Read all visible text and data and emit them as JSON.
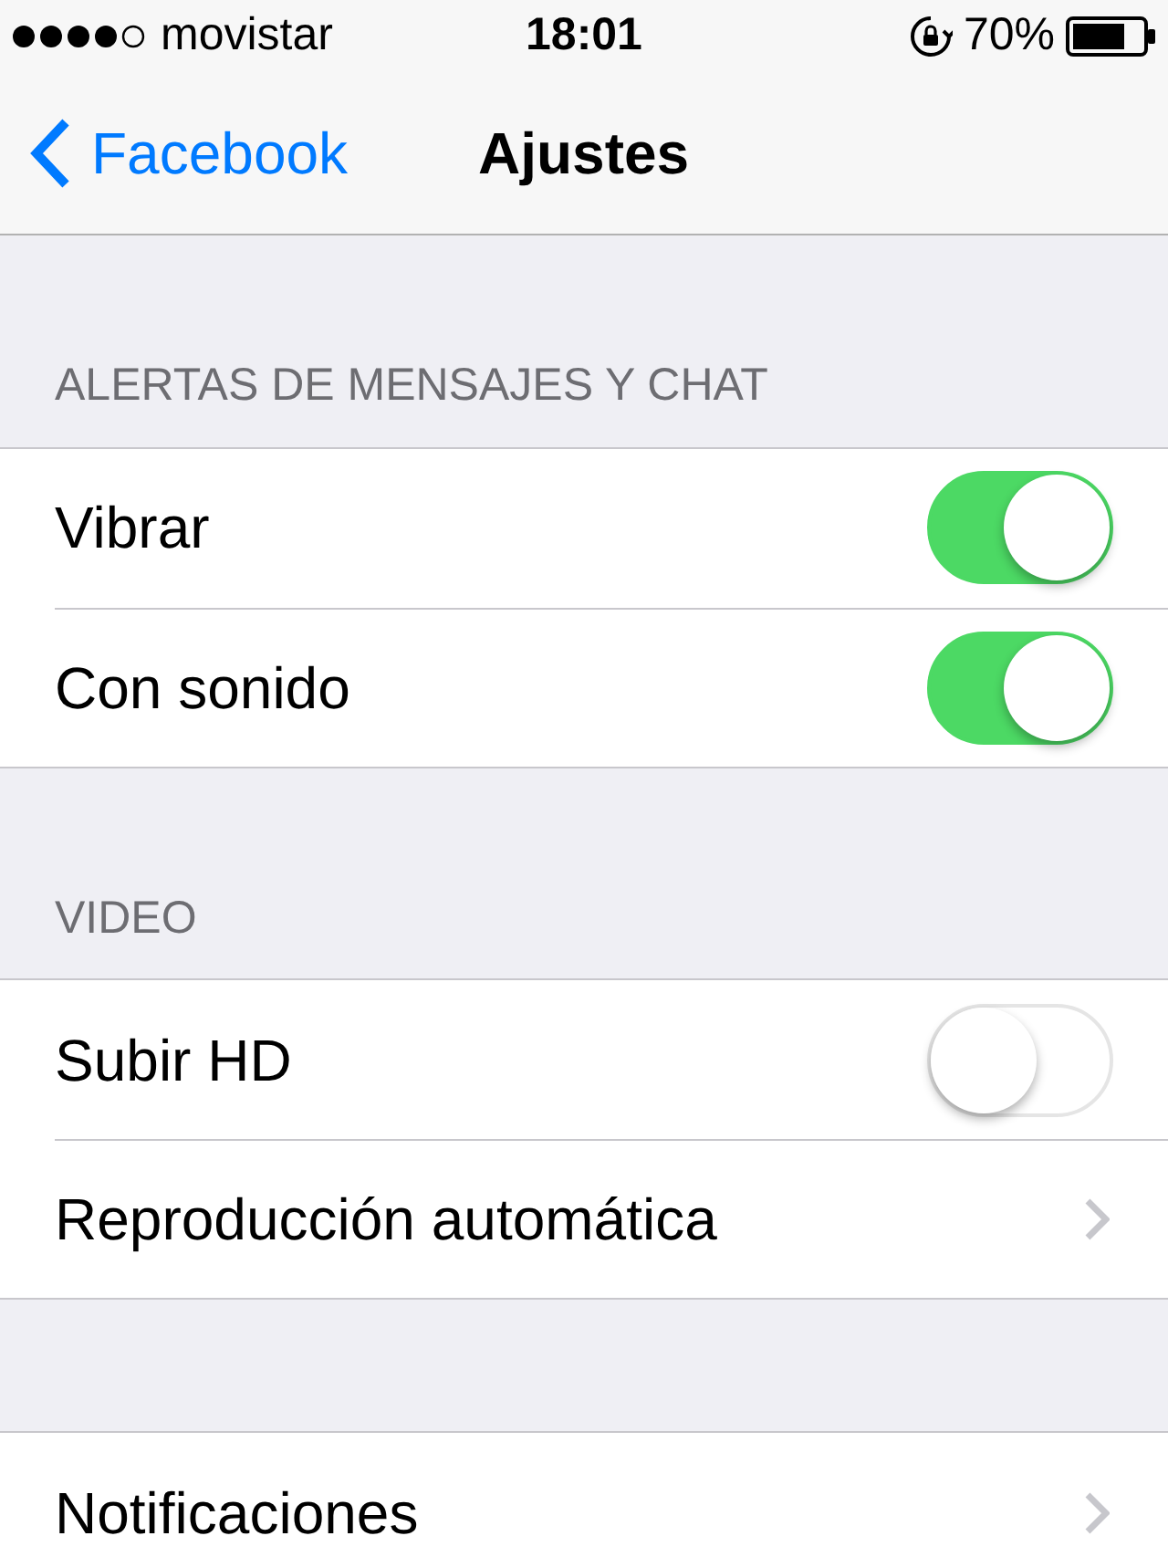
{
  "status_bar": {
    "carrier": "movistar",
    "time": "18:01",
    "battery": "70%"
  },
  "nav": {
    "back": "Facebook",
    "title": "Ajustes"
  },
  "sections": [
    {
      "header": "ALERTAS DE MENSAJES Y CHAT",
      "rows": [
        {
          "kind": "toggle",
          "label": "Vibrar",
          "on": true
        },
        {
          "kind": "toggle",
          "label": "Con sonido",
          "on": true
        }
      ]
    },
    {
      "header": "VIDEO",
      "rows": [
        {
          "kind": "toggle",
          "label": "Subir HD",
          "on": false
        },
        {
          "kind": "disclosure",
          "label": "Reproducción automática"
        }
      ]
    },
    {
      "rows": [
        {
          "kind": "disclosure",
          "label": "Notificaciones"
        }
      ]
    }
  ]
}
